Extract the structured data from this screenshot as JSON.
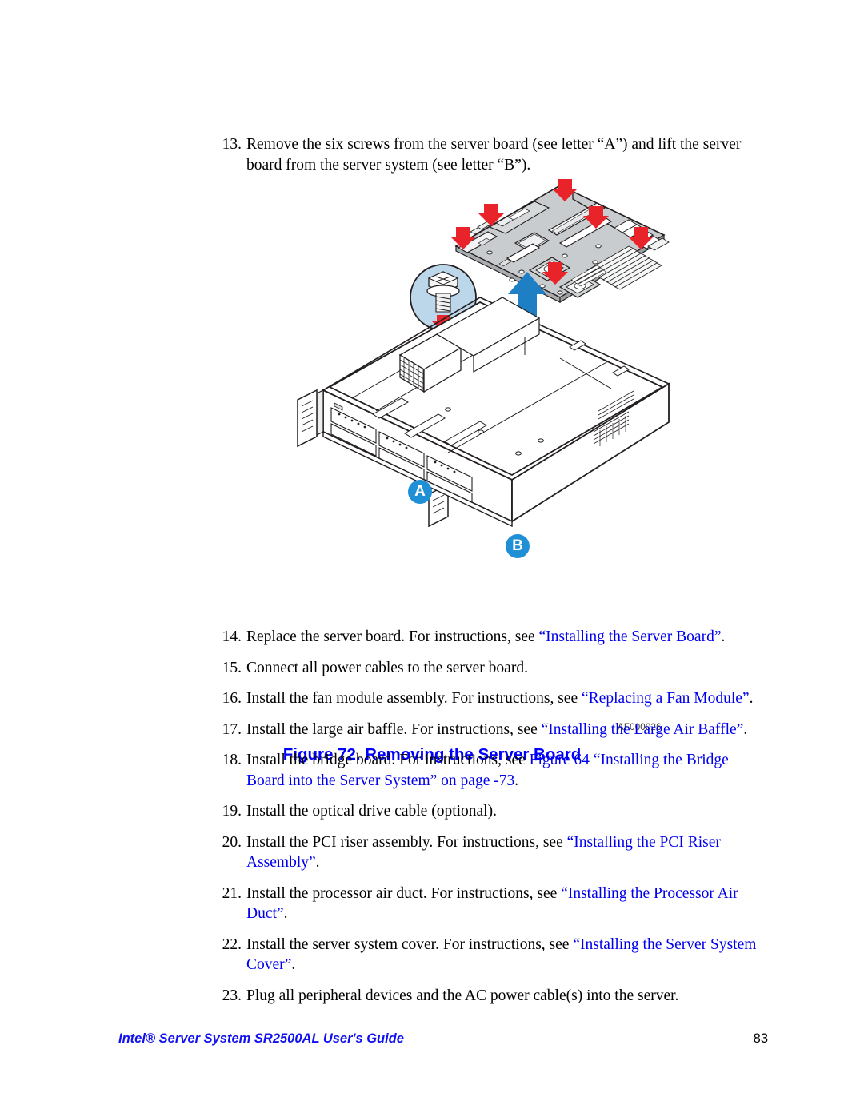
{
  "page": {
    "number": "83",
    "footer_title": "Intel® Server System SR2500AL User's Guide"
  },
  "colors": {
    "link_blue": "#0000ee",
    "caption_blue": "#0000ff",
    "footer_blue": "#1010f0",
    "arrow_red": "#e8242a",
    "arrow_blue": "#1f7fc4",
    "callout_badge": "#1f8fd6",
    "callout_disc": "#bcd6ea",
    "board_gray": "#c9ccce",
    "line_black": "#231f20"
  },
  "steps_top": [
    {
      "number": "13.",
      "segments": [
        {
          "text": "Remove the six screws from the server board (see letter “A”) and lift the server board from the server system (see letter “B”).",
          "link": false
        }
      ]
    }
  ],
  "figure": {
    "art_id": "AF000026",
    "caption": "Figure 72. Removing the Server Board",
    "callouts": [
      {
        "letter": "A",
        "meaning": "screw-detail"
      },
      {
        "letter": "B",
        "meaning": "lift-direction"
      }
    ],
    "screw_arrow_count": 6
  },
  "steps_bottom": [
    {
      "number": "14.",
      "segments": [
        {
          "text": "Replace the server board. For instructions, see ",
          "link": false
        },
        {
          "text": "“Installing the Server Board”",
          "link": true
        },
        {
          "text": ".",
          "link": false
        }
      ]
    },
    {
      "number": "15.",
      "segments": [
        {
          "text": "Connect all power cables to the server board.",
          "link": false
        }
      ]
    },
    {
      "number": "16.",
      "segments": [
        {
          "text": "Install the fan module assembly. For instructions, see ",
          "link": false
        },
        {
          "text": "“Replacing a Fan Module”",
          "link": true
        },
        {
          "text": ".",
          "link": false
        }
      ]
    },
    {
      "number": "17.",
      "segments": [
        {
          "text": "Install the large air baffle. For instructions, see ",
          "link": false
        },
        {
          "text": "“Installing the Large Air Baffle”",
          "link": true
        },
        {
          "text": ".",
          "link": false
        }
      ]
    },
    {
      "number": "18.",
      "segments": [
        {
          "text": "Install the bridge board. For instructions, see ",
          "link": false
        },
        {
          "text": "Figure 64 “Installing the Bridge Board into the Server System” on page -73",
          "link": true
        },
        {
          "text": ".",
          "link": false
        }
      ]
    },
    {
      "number": "19.",
      "segments": [
        {
          "text": "Install the optical drive cable (optional).",
          "link": false
        }
      ]
    },
    {
      "number": "20.",
      "segments": [
        {
          "text": "Install the PCI riser assembly. For instructions, see ",
          "link": false
        },
        {
          "text": "“Installing the PCI Riser Assembly”",
          "link": true
        },
        {
          "text": ".",
          "link": false
        }
      ]
    },
    {
      "number": "21.",
      "segments": [
        {
          "text": "Install the processor air duct. For instructions, see ",
          "link": false
        },
        {
          "text": "“Installing the Processor Air Duct”",
          "link": true
        },
        {
          "text": ".",
          "link": false
        }
      ]
    },
    {
      "number": "22.",
      "segments": [
        {
          "text": "Install the server system cover. For instructions, see ",
          "link": false
        },
        {
          "text": "“Installing the Server System Cover”",
          "link": true
        },
        {
          "text": ".",
          "link": false
        }
      ]
    },
    {
      "number": "23.",
      "segments": [
        {
          "text": "Plug all peripheral devices and the AC power cable(s) into the server.",
          "link": false
        }
      ]
    }
  ]
}
